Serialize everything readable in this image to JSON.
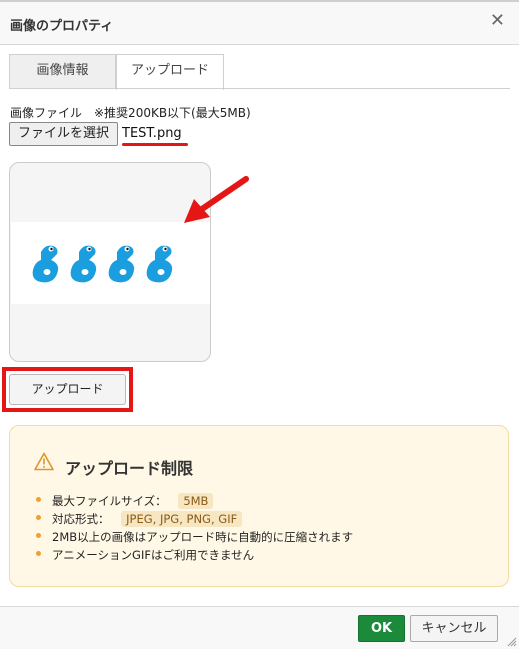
{
  "dialog": {
    "title": "画像のプロパティ",
    "close_icon": "close-icon"
  },
  "tabs": [
    {
      "label": "画像情報",
      "active": false
    },
    {
      "label": "アップロード",
      "active": true
    }
  ],
  "upload": {
    "file_label": "画像ファイル　※推奨200KB以下(最大5MB)",
    "choose_file_label": "ファイルを選択",
    "file_name": "TEST.png",
    "upload_button_label": "アップロード"
  },
  "notice": {
    "icon": "warning-icon",
    "title": "アップロード制限",
    "items": [
      {
        "text": "最大ファイルサイズ：",
        "value": "5MB"
      },
      {
        "text": "対応形式：",
        "value": "JPEG, JPG, PNG, GIF"
      },
      {
        "text": "2MB以上の画像はアップロード時に自動的に圧縮されます",
        "value": ""
      },
      {
        "text": "アニメーションGIFはご利用できません",
        "value": ""
      }
    ]
  },
  "footer": {
    "ok_label": "OK",
    "cancel_label": "キャンセル"
  },
  "colors": {
    "annotation_red": "#e51616",
    "ok_green": "#1c8a3b",
    "notice_bg": "#fff8e6",
    "bird_blue": "#1a9ee0"
  }
}
